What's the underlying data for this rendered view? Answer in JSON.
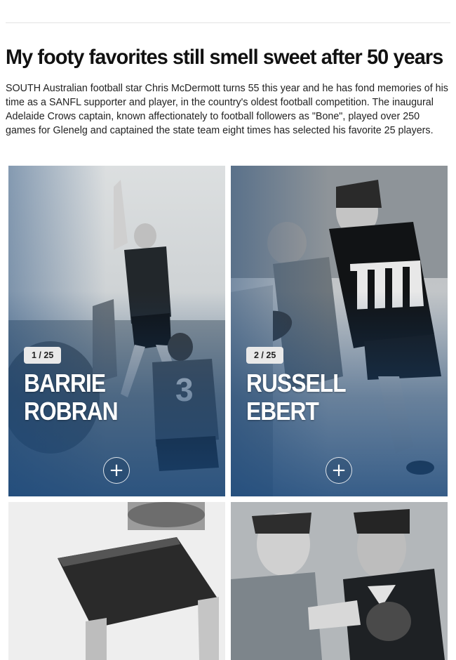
{
  "article": {
    "headline": "My footy favorites still smell sweet after 50 years",
    "intro": "SOUTH Australian football star Chris McDermott turns 55 this year and he has fond memories of his time as a SANFL supporter and player, in the country's oldest football competition. The inaugural Adelaide Crows captain, known affectionately to football followers as \"Bone\", played over 250 games for Glenelg and captained the state team eight times has selected his favorite 25 players."
  },
  "cards": [
    {
      "counter": "1 / 25",
      "first": "BARRIE",
      "last": "ROBRAN",
      "expand": "+"
    },
    {
      "counter": "2 / 25",
      "first": "RUSSELL",
      "last": "EBERT",
      "expand": "+"
    }
  ],
  "icons": [
    "plus-icon"
  ],
  "colors": {
    "card_overlay": "#1b487a",
    "badge_bg": "#e9e9e9",
    "headline": "#111111"
  }
}
